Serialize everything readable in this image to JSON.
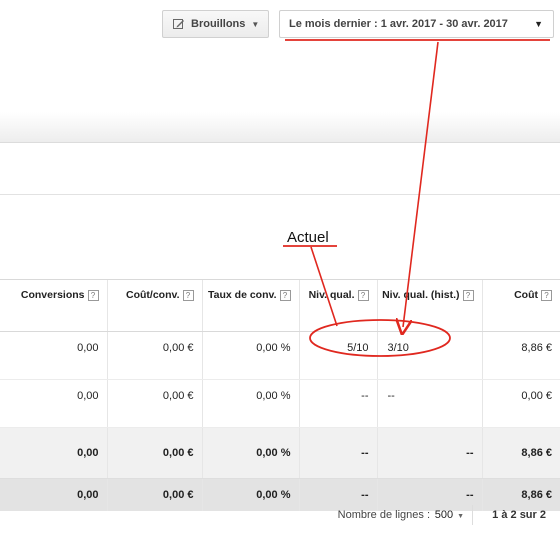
{
  "toolbar": {
    "drafts_label": "Brouillons",
    "date_range_label": "Le mois dernier : 1 avr. 2017 - 30 avr. 2017"
  },
  "table": {
    "columns": [
      {
        "label": "Conversions"
      },
      {
        "label": "Coût/conv."
      },
      {
        "label": "Taux de conv."
      },
      {
        "label": "Niv. qual."
      },
      {
        "label": "Niv. qual. (hist.)"
      },
      {
        "label": "Coût"
      }
    ],
    "rows": [
      [
        "0,00",
        "0,00 €",
        "0,00 %",
        "5/10",
        "3/10",
        "8,86 €"
      ],
      [
        "0,00",
        "0,00 €",
        "0,00 %",
        "--",
        "--",
        "0,00 €"
      ],
      [
        "0,00",
        "0,00 €",
        "0,00 %",
        "--",
        "--",
        "8,86 €"
      ],
      [
        "0,00",
        "0,00 €",
        "0,00 %",
        "--",
        "--",
        "8,86 €"
      ]
    ]
  },
  "pagination": {
    "rows_label": "Nombre de lignes :",
    "rows_value": "500",
    "range_label": "1 à 2 sur 2"
  },
  "annotation": {
    "label": "Actuel",
    "color": "#e0281f"
  }
}
